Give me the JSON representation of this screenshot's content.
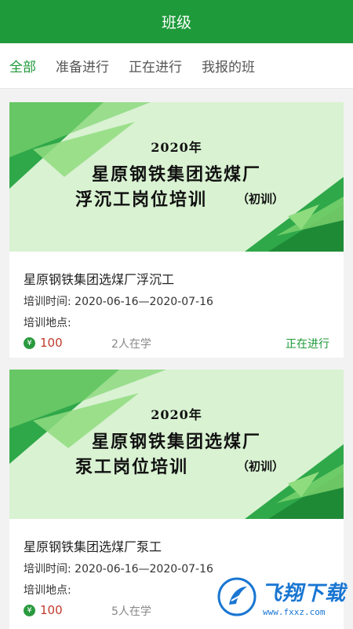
{
  "header": {
    "title": "班级"
  },
  "tabs": [
    {
      "label": "全部",
      "active": true
    },
    {
      "label": "准备进行",
      "active": false
    },
    {
      "label": "正在进行",
      "active": false
    },
    {
      "label": "我报的班",
      "active": false
    }
  ],
  "classes": [
    {
      "banner": {
        "year": "2020年",
        "line1": "星原钢铁集团选煤厂",
        "line2": "浮沉工岗位培训",
        "note": "（初训）"
      },
      "title": "星原钢铁集团选煤厂浮沉工",
      "time": "培训时间: 2020-06-16—2020-07-16",
      "place": "培训地点:",
      "coin_symbol": "¥",
      "price": "100",
      "learners": "2人在学",
      "status": "正在进行"
    },
    {
      "banner": {
        "year": "2020年",
        "line1": "星原钢铁集团选煤厂",
        "line2": "泵工岗位培训",
        "note": "（初训）"
      },
      "title": "星原钢铁集团选煤厂泵工",
      "time": "培训时间: 2020-06-16—2020-07-16",
      "place": "培训地点:",
      "coin_symbol": "¥",
      "price": "100",
      "learners": "5人在学",
      "status": ""
    }
  ],
  "watermark": {
    "main": "飞翔下载",
    "sub": "www.fxxz.com"
  },
  "colors": {
    "primary": "#1e9a3a",
    "price": "#c0392b",
    "banner_bg": "#d9f2d2"
  }
}
